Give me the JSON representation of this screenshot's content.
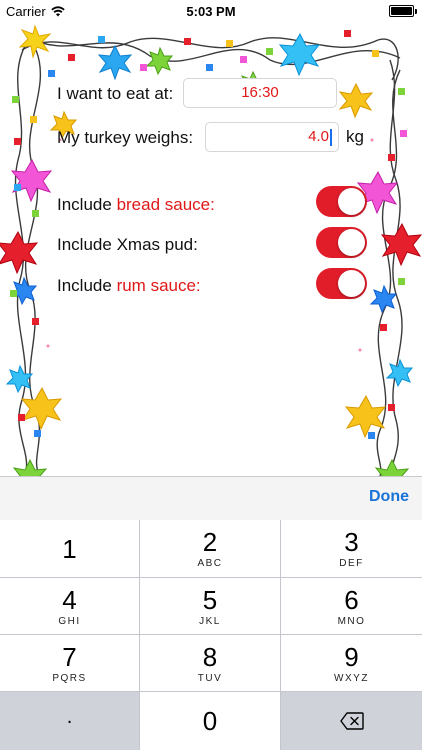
{
  "status_bar": {
    "carrier": "Carrier",
    "time": "5:03 PM"
  },
  "form": {
    "eat_label": "I want to eat at:",
    "eat_time": "16:30",
    "turkey_label": "My turkey weighs:",
    "turkey_weight": "4.0",
    "turkey_unit": "kg",
    "options": [
      {
        "prefix": "Include",
        "accent": "bread sauce:",
        "plain": "",
        "on": true
      },
      {
        "prefix": "Include",
        "accent": "",
        "plain": "Xmas pud:",
        "on": true
      },
      {
        "prefix": "Include",
        "accent": "rum sauce:",
        "plain": "",
        "on": true
      }
    ]
  },
  "keyboard": {
    "done_label": "Done",
    "keys": [
      {
        "num": "1",
        "letters": ""
      },
      {
        "num": "2",
        "letters": "ABC"
      },
      {
        "num": "3",
        "letters": "DEF"
      },
      {
        "num": "4",
        "letters": "GHI"
      },
      {
        "num": "5",
        "letters": "JKL"
      },
      {
        "num": "6",
        "letters": "MNO"
      },
      {
        "num": "7",
        "letters": "PQRS"
      },
      {
        "num": "8",
        "letters": "TUV"
      },
      {
        "num": "9",
        "letters": "WXYZ"
      },
      {
        "num": ".",
        "letters": ""
      },
      {
        "num": "0",
        "letters": ""
      }
    ]
  },
  "colors": {
    "accent": "#e01818",
    "toggle_on": "#e21d2a",
    "done": "#1a74d8"
  }
}
